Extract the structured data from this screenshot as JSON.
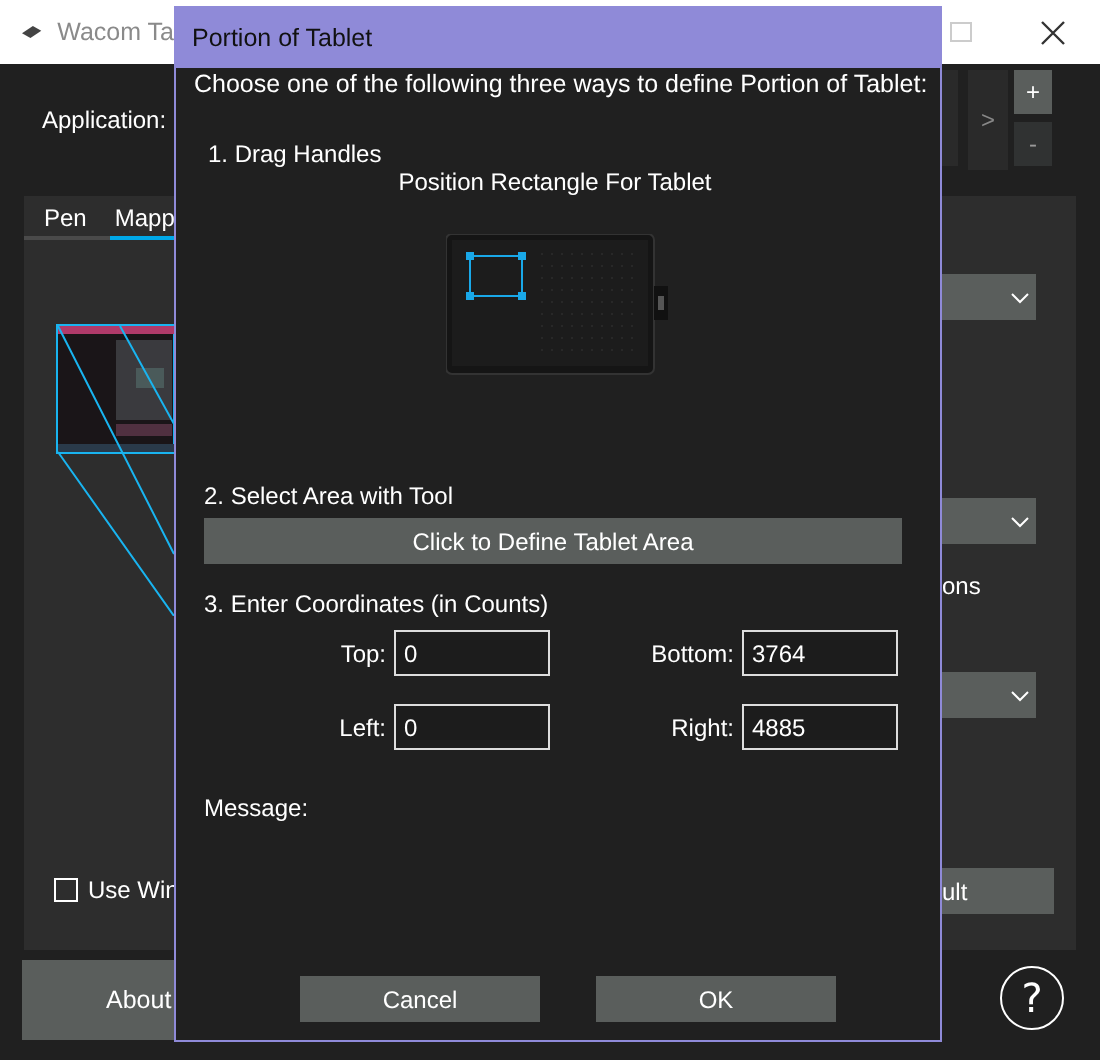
{
  "main_window": {
    "title": "Wacom Ta",
    "application_label": "Application:",
    "nav_button": ">",
    "add_button": "+",
    "remove_button": "-",
    "tabs": [
      {
        "label": "Pen",
        "selected": false
      },
      {
        "label": "Mapp",
        "selected": true
      }
    ],
    "options_text": "ons",
    "use_checkbox": {
      "label": "Use Win",
      "checked": false
    },
    "default_button": "ult",
    "about_button": "About",
    "help_button": "?"
  },
  "dialog": {
    "title": "Portion of Tablet",
    "intro": "Choose one of the following three ways to define Portion of Tablet:",
    "step1": "1. Drag Handles",
    "tablet_caption": "Position Rectangle For Tablet",
    "step2": "2. Select Area with Tool",
    "define_button": "Click to Define Tablet Area",
    "step3": "3. Enter Coordinates (in Counts)",
    "fields": [
      {
        "label": "Top:",
        "value": "0"
      },
      {
        "label": "Bottom:",
        "value": "3764"
      },
      {
        "label": "Left:",
        "value": "0"
      },
      {
        "label": "Right:",
        "value": "4885"
      }
    ],
    "message_label": "Message:",
    "buttons": [
      "Cancel",
      "OK"
    ]
  }
}
